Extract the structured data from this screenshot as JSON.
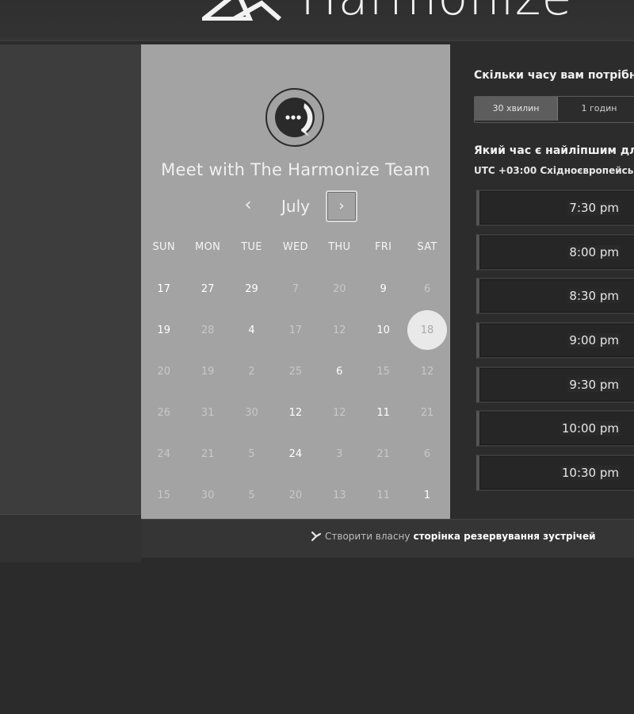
{
  "header": {
    "brand_name": "Harmonize"
  },
  "calendar": {
    "title": "Meet with The Harmonize Team",
    "month": "July",
    "prev_icon": "‹",
    "next_icon": "›",
    "weekdays": [
      "SUN",
      "MON",
      "TUE",
      "WED",
      "THU",
      "FRI",
      "SAT"
    ],
    "weeks": [
      [
        {
          "d": "17",
          "a": true
        },
        {
          "d": "27",
          "a": true
        },
        {
          "d": "29",
          "a": true
        },
        {
          "d": "7",
          "a": false
        },
        {
          "d": "20",
          "a": false
        },
        {
          "d": "9",
          "a": true
        },
        {
          "d": "6",
          "a": false
        }
      ],
      [
        {
          "d": "19",
          "a": true
        },
        {
          "d": "28",
          "a": false
        },
        {
          "d": "4",
          "a": true
        },
        {
          "d": "17",
          "a": false
        },
        {
          "d": "12",
          "a": false
        },
        {
          "d": "10",
          "a": true
        },
        {
          "d": "18",
          "a": true,
          "selected": true
        }
      ],
      [
        {
          "d": "20",
          "a": false
        },
        {
          "d": "19",
          "a": false
        },
        {
          "d": "2",
          "a": false
        },
        {
          "d": "25",
          "a": false
        },
        {
          "d": "6",
          "a": true
        },
        {
          "d": "15",
          "a": false
        },
        {
          "d": "12",
          "a": false
        }
      ],
      [
        {
          "d": "26",
          "a": false
        },
        {
          "d": "31",
          "a": false
        },
        {
          "d": "30",
          "a": false
        },
        {
          "d": "12",
          "a": true
        },
        {
          "d": "12",
          "a": false
        },
        {
          "d": "11",
          "a": true
        },
        {
          "d": "21",
          "a": false
        }
      ],
      [
        {
          "d": "24",
          "a": false
        },
        {
          "d": "21",
          "a": false
        },
        {
          "d": "5",
          "a": false
        },
        {
          "d": "24",
          "a": true
        },
        {
          "d": "3",
          "a": false
        },
        {
          "d": "21",
          "a": false
        },
        {
          "d": "6",
          "a": false
        }
      ],
      [
        {
          "d": "15",
          "a": false
        },
        {
          "d": "30",
          "a": false
        },
        {
          "d": "5",
          "a": false
        },
        {
          "d": "20",
          "a": false
        },
        {
          "d": "13",
          "a": false
        },
        {
          "d": "11",
          "a": false
        },
        {
          "d": "1",
          "a": true
        }
      ]
    ]
  },
  "times": {
    "duration_question": "Скільки часу вам потрібно",
    "durations": [
      {
        "label": "30 хвилин",
        "selected": true
      },
      {
        "label": "1 годин",
        "selected": false
      }
    ],
    "time_question": "Який час є найліпшим для",
    "timezone": "UTC +03:00 Східноєвропейсь",
    "slots": [
      "7:30 pm",
      "8:00 pm",
      "8:30 pm",
      "9:00 pm",
      "9:30 pm",
      "10:00 pm",
      "10:30 pm"
    ]
  },
  "footer": {
    "prefix": "Створити власну",
    "link": "сторінка резервування зустрічей"
  },
  "colors": {
    "page_bg": "#2b2b2b",
    "calendar_bg": "#a3a3a3",
    "selected_day": "#e9e9e9",
    "time_panel_bg": "#2c2c2c"
  }
}
